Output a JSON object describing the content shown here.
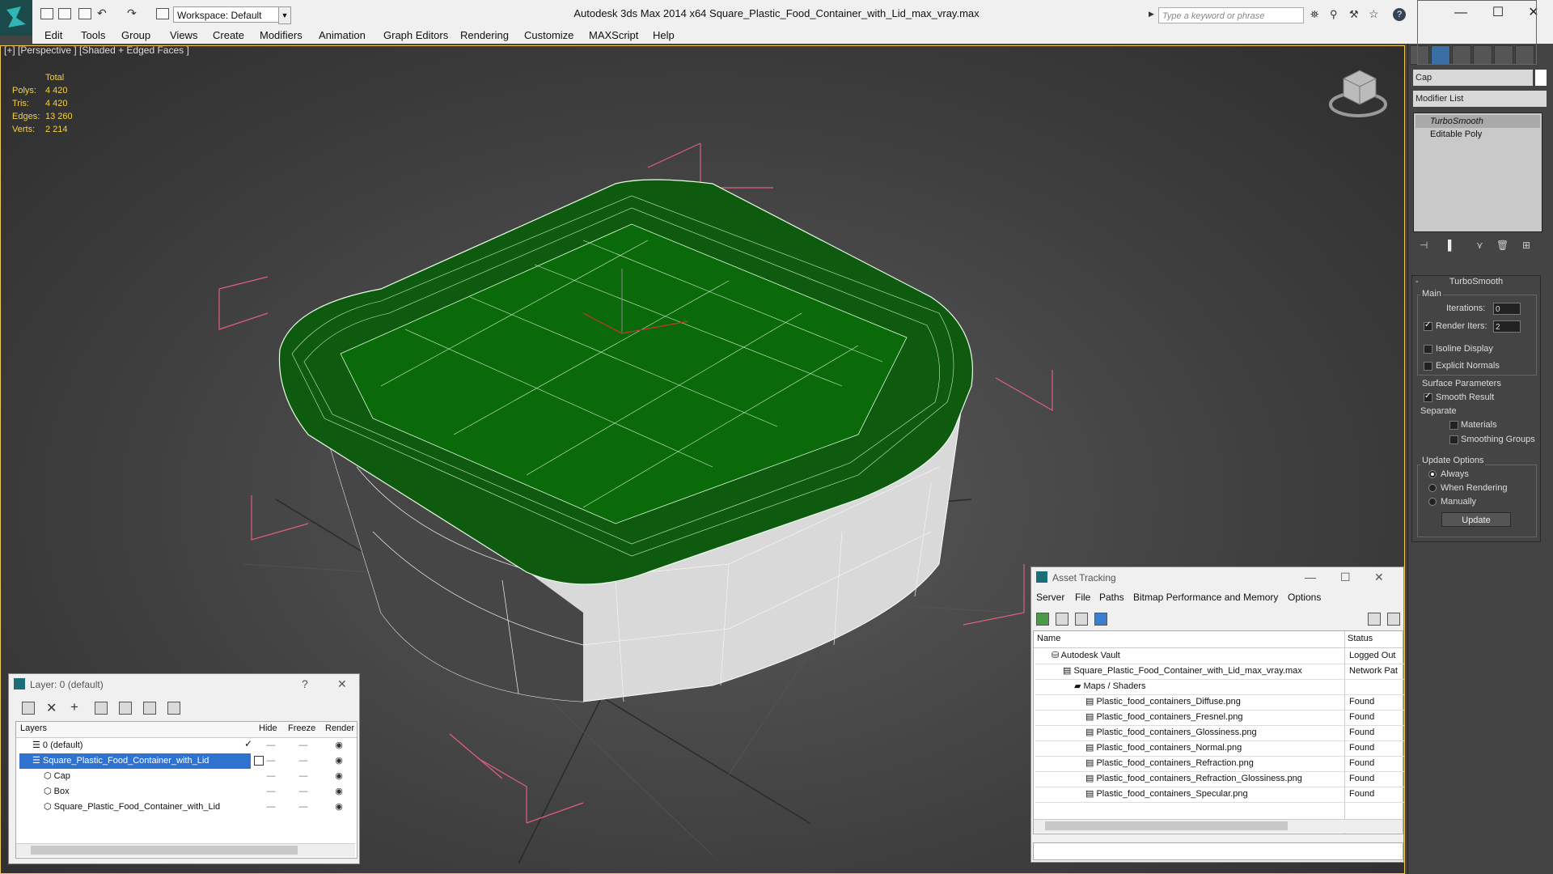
{
  "app": {
    "window_title": "Autodesk 3ds Max  2014 x64      Square_Plastic_Food_Container_with_Lid_max_vray.max",
    "workspace": "Workspace: Default",
    "search_placeholder": "Type a keyword or phrase",
    "window_controls": [
      "—",
      "☐",
      "✕"
    ]
  },
  "menu": [
    "Edit",
    "Tools",
    "Group",
    "Views",
    "Create",
    "Modifiers",
    "Animation",
    "Graph Editors",
    "Rendering",
    "Customize",
    "MAXScript",
    "Help"
  ],
  "viewport": {
    "label": "[+] [Perspective ] [Shaded + Edged Faces ]",
    "stats_header": "Total",
    "stats": [
      {
        "label": "Polys:",
        "value": "4 420"
      },
      {
        "label": "Tris:",
        "value": "4 420"
      },
      {
        "label": "Edges:",
        "value": "13 260"
      },
      {
        "label": "Verts:",
        "value": "2 214"
      }
    ]
  },
  "command_panel": {
    "object_name": "Cap",
    "modifier_list": "Modifier List",
    "stack": [
      "TurboSmooth",
      "Editable Poly"
    ],
    "rollout_title": "TurboSmooth",
    "main_group": "Main",
    "iterations_label": "Iterations:",
    "iterations_value": "0",
    "render_iters_label": "Render Iters:",
    "render_iters_value": "2",
    "isoline": "Isoline Display",
    "explicit_normals": "Explicit Normals",
    "surface_group": "Surface Parameters",
    "smooth_result": "Smooth Result",
    "separate": "Separate",
    "materials": "Materials",
    "smoothing_groups": "Smoothing Groups",
    "update_group": "Update Options",
    "always": "Always",
    "when_rendering": "When Rendering",
    "manually": "Manually",
    "update_button": "Update",
    "checks": {
      "render_iters": true,
      "isoline": false,
      "explicit_normals": false,
      "smooth_result": true,
      "materials": false,
      "smoothing_groups": false
    },
    "update_option": "Always"
  },
  "layers": {
    "title": "Layer: 0 (default)",
    "help": "?",
    "close": "✕",
    "columns": {
      "layers": "Layers",
      "hide": "Hide",
      "freeze": "Freeze",
      "render": "Render"
    },
    "rows": [
      {
        "name": "0 (default)",
        "indent": 0
      },
      {
        "name": "Square_Plastic_Food_Container_with_Lid",
        "indent": 0,
        "selected": true
      },
      {
        "name": "Cap",
        "indent": 1
      },
      {
        "name": "Box",
        "indent": 1
      },
      {
        "name": "Square_Plastic_Food_Container_with_Lid",
        "indent": 1
      }
    ]
  },
  "asset_tracking": {
    "title": "Asset Tracking",
    "menu": [
      "Server",
      "File",
      "Paths",
      "Bitmap Performance and Memory",
      "Options"
    ],
    "columns": {
      "name": "Name",
      "status": "Status"
    },
    "rows": [
      {
        "name": "Autodesk Vault",
        "status": "Logged Out",
        "indent": 0
      },
      {
        "name": "Square_Plastic_Food_Container_with_Lid_max_vray.max",
        "status": "Network Pat",
        "indent": 1
      },
      {
        "name": "Maps / Shaders",
        "status": "",
        "indent": 2
      },
      {
        "name": "Plastic_food_containers_Diffuse.png",
        "status": "Found",
        "indent": 3
      },
      {
        "name": "Plastic_food_containers_Fresnel.png",
        "status": "Found",
        "indent": 3
      },
      {
        "name": "Plastic_food_containers_Glossiness.png",
        "status": "Found",
        "indent": 3
      },
      {
        "name": "Plastic_food_containers_Normal.png",
        "status": "Found",
        "indent": 3
      },
      {
        "name": "Plastic_food_containers_Refraction.png",
        "status": "Found",
        "indent": 3
      },
      {
        "name": "Plastic_food_containers_Refraction_Glossiness.png",
        "status": "Found",
        "indent": 3
      },
      {
        "name": "Plastic_food_containers_Specular.png",
        "status": "Found",
        "indent": 3
      }
    ]
  }
}
